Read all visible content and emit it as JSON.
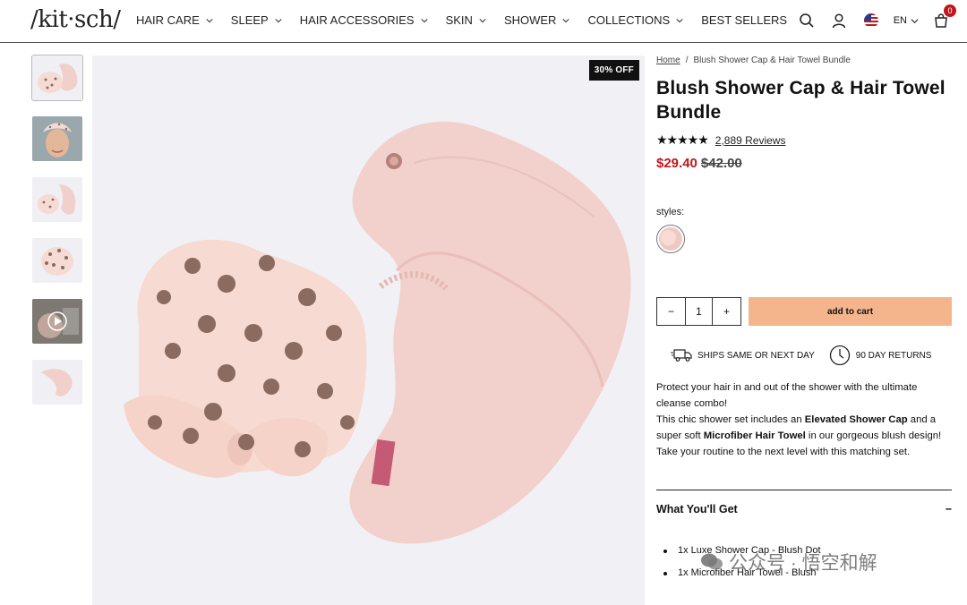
{
  "header": {
    "logo": "/kit·sch/",
    "nav": [
      {
        "label": "HAIR CARE",
        "dropdown": true
      },
      {
        "label": "SLEEP",
        "dropdown": true
      },
      {
        "label": "HAIR ACCESSORIES",
        "dropdown": true
      },
      {
        "label": "SKIN",
        "dropdown": true
      },
      {
        "label": "SHOWER",
        "dropdown": true
      },
      {
        "label": "COLLECTIONS",
        "dropdown": true
      },
      {
        "label": "BEST SELLERS",
        "dropdown": false
      }
    ],
    "language": "EN",
    "cart_count": "0"
  },
  "gallery": {
    "badge": "30% OFF",
    "thumbnails": [
      "polka-dot-cap-and-towel",
      "model-wearing-bow-cap",
      "cap-and-towel-set",
      "polka-dot-cap",
      "product-video",
      "blush-towel"
    ],
    "active_thumb": 0
  },
  "product": {
    "breadcrumb": {
      "home": "Home",
      "separator": "/",
      "current": "Blush Shower Cap & Hair Towel Bundle"
    },
    "title": "Blush Shower Cap & Hair Towel Bundle",
    "stars": "★★★★★",
    "reviews": "2,889 Reviews",
    "sale_price": "$29.40",
    "original_price": "$42.00",
    "styles_label": "styles:",
    "quantity": "1",
    "qty_minus": "−",
    "qty_plus": "+",
    "add_to_cart": "add to cart",
    "shipping": "SHIPS SAME OR NEXT DAY",
    "returns": "90 DAY RETURNS",
    "description": {
      "p1": "Protect your hair in and out of the shower with the ultimate cleanse combo!",
      "p2_a": "This chic shower set includes an ",
      "p2_b": "Elevated Shower Cap",
      "p2_c": " and a super soft ",
      "p2_d": "Microfiber Hair Towel",
      "p2_e": " in our gorgeous blush design! Take your routine to the next level with this matching set."
    },
    "what_you_get": {
      "heading": "What You'll Get",
      "toggle": "−",
      "items": [
        "1x Luxe Shower Cap - Blush Dot",
        "1x Microfiber Hair Towel - Blush"
      ]
    }
  },
  "watermark": "公众号 · 悟空和解",
  "colors": {
    "accent": "#f5b58c",
    "sale": "#c0171d",
    "badge_bg": "#111111",
    "image_bg": "#f1f0f4"
  }
}
